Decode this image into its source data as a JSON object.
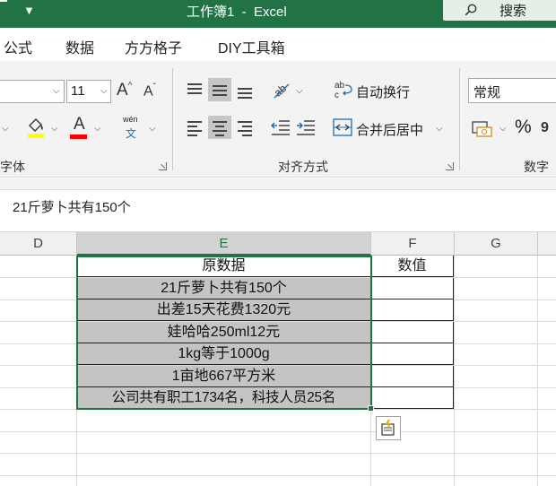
{
  "titlebar": {
    "quick_access_arrow": "▼",
    "title": "工作簿1  -  Excel",
    "search_label": "搜索",
    "search_icon": "search-icon"
  },
  "ribbon_tabs": [
    "公式",
    "数据",
    "方方格子",
    "DIY工具箱"
  ],
  "ribbon": {
    "font_size": "11",
    "font_group_label": "字体",
    "align_group_label": "对齐方式",
    "number_group_label": "数字",
    "wrap_text_label": "自动换行",
    "merge_center_label": "合并后居中",
    "number_format": "常规",
    "percent_symbol": "%",
    "wen_top": "wén",
    "wen_bottom": "文",
    "grow_font": "A^",
    "shrink_font": "A˅",
    "font_color_letter": "A",
    "accent_color": "#217346",
    "highlight_color": "#FFFF00",
    "font_color": "#FF0000"
  },
  "formula_bar": {
    "content": "21斤萝卜共有150个"
  },
  "columns": [
    "D",
    "E",
    "F",
    "G"
  ],
  "active_column": "E",
  "table": {
    "header": "原数据",
    "value_header": "数值",
    "rows": [
      "21斤萝卜共有150个",
      "出差15天花费1320元",
      "娃哈哈250ml12元",
      "1kg等于1000g",
      "1亩地667平方米",
      "公司共有职工1734名，科技人员25名"
    ]
  }
}
